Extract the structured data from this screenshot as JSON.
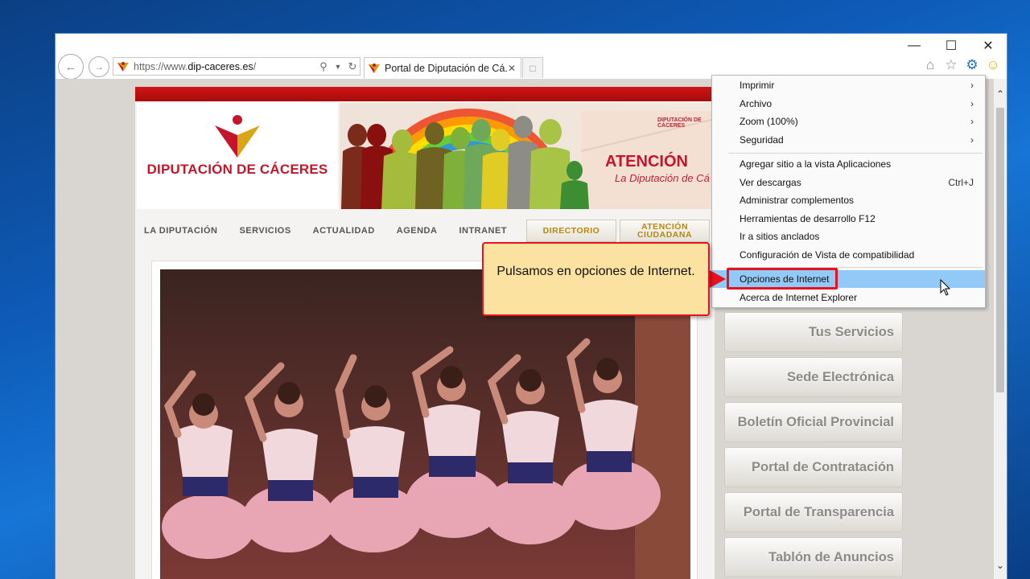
{
  "browser": {
    "url_prefix": "https://www.",
    "url_domain": "dip-caceres.es",
    "url_suffix": "/",
    "tab_title": "Portal de Diputación de Cá...",
    "window_controls": [
      "minimize-icon",
      "maximize-icon",
      "close-icon"
    ]
  },
  "site": {
    "logo_text": "DIPUTACIÓN DE CÁCERES",
    "banner_title": "ATENCIÓN",
    "banner_subtitle": "La Diputación de Cá",
    "banner_small": "DIPUTACIÓN DE CÁCERES",
    "menu": [
      "LA DIPUTACIÓN",
      "SERVICIOS",
      "ACTUALIDAD",
      "AGENDA",
      "INTRANET"
    ],
    "directorio": "DIRECTORIO",
    "atencion_1": "ATENCIÓN",
    "atencion_2": "CIUDADANA",
    "side_buttons": [
      "Tus Servicios",
      "Sede Electrónica",
      "Boletín Oficial Provincial",
      "Portal de Contratación",
      "Portal de Transparencia",
      "Tablón de Anuncios"
    ]
  },
  "context_menu": {
    "items": [
      {
        "label": "Imprimir",
        "right": "›"
      },
      {
        "label": "Archivo",
        "right": "›"
      },
      {
        "label": "Zoom (100%)",
        "right": "›"
      },
      {
        "label": "Seguridad",
        "right": "›"
      },
      {
        "label": "Agregar sitio a la vista Aplicaciones",
        "right": ""
      },
      {
        "label": "Ver descargas",
        "right": "Ctrl+J"
      },
      {
        "label": "Administrar complementos",
        "right": ""
      },
      {
        "label": "Herramientas de desarrollo F12",
        "right": ""
      },
      {
        "label": "Ir a sitios anclados",
        "right": ""
      },
      {
        "label": "Configuración de Vista de compatibilidad",
        "right": ""
      },
      {
        "label": "Opciones de Internet",
        "right": ""
      },
      {
        "label": "Acerca de Internet Explorer",
        "right": ""
      }
    ],
    "highlighted": "Opciones de Internet"
  },
  "callout": {
    "text": "Pulsamos en opciones de Internet."
  }
}
